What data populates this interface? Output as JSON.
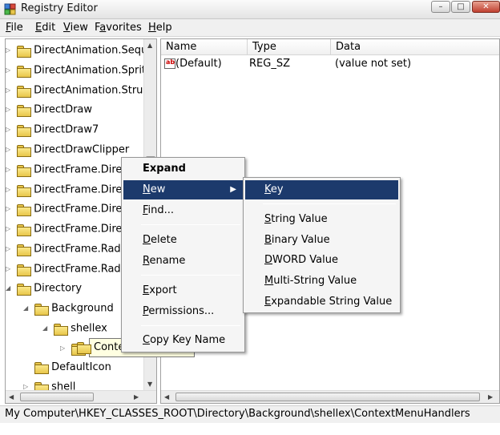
{
  "window": {
    "title": "Registry Editor",
    "minimize": "–",
    "maximize": "□",
    "close": "✕"
  },
  "menubar": [
    {
      "first": "F",
      "rest": "ile"
    },
    {
      "first": "E",
      "rest": "dit"
    },
    {
      "first": "V",
      "rest": "iew"
    },
    {
      "first": "F",
      "rest": "avorites",
      "pre": "Fa",
      "post": "vorites"
    },
    {
      "first": "H",
      "rest": "elp"
    }
  ],
  "tree": {
    "items": [
      "DirectAnimation.Sequen",
      "DirectAnimation.SpriteC",
      "DirectAnimation.Structu",
      "DirectDraw",
      "DirectDraw7",
      "DirectDrawClipper",
      "DirectFrame.Direct",
      "DirectFrame.Direct",
      "DirectFrame.Direct",
      "DirectFrame.Direct",
      "DirectFrame.Radio",
      "DirectFrame.Radio",
      "Directory",
      "Background",
      "shellex",
      "Conte",
      "DefaultIcon",
      "shell"
    ]
  },
  "list": {
    "headers": {
      "name": "Name",
      "type": "Type",
      "data": "Data"
    },
    "rows": [
      {
        "name": "(Default)",
        "type": "REG_SZ",
        "data": "(value not set)"
      }
    ]
  },
  "context_menu": {
    "items": [
      {
        "label": "Expand"
      },
      {
        "label": "New",
        "u": "N",
        "rest": "ew"
      },
      {
        "label": "Find...",
        "u": "F",
        "rest": "ind..."
      },
      {
        "label": "Delete",
        "u": "D",
        "rest": "elete"
      },
      {
        "label": "Rename",
        "u": "R",
        "rest": "ename"
      },
      {
        "label": "Export",
        "u": "E",
        "rest": "xport"
      },
      {
        "label": "Permissions...",
        "u": "P",
        "rest": "ermissions..."
      },
      {
        "label": "Copy Key Name",
        "u": "C",
        "rest": "opy Key Name"
      }
    ],
    "submenu_arrow": "▶"
  },
  "submenu": {
    "items": [
      {
        "u": "K",
        "rest": "ey"
      },
      {
        "u": "S",
        "rest": "tring Value"
      },
      {
        "u": "B",
        "rest": "inary Value"
      },
      {
        "u": "D",
        "rest": "WORD Value"
      },
      {
        "u": "M",
        "rest": "ulti-String Value"
      },
      {
        "u": "E",
        "rest": "xpandable String Value"
      }
    ]
  },
  "statusbar": {
    "path": "My Computer\\HKEY_CLASSES_ROOT\\Directory\\Background\\shellex\\ContextMenuHandlers"
  },
  "icons": {
    "tree_expand": "▷",
    "tree_collapse": "◢"
  }
}
